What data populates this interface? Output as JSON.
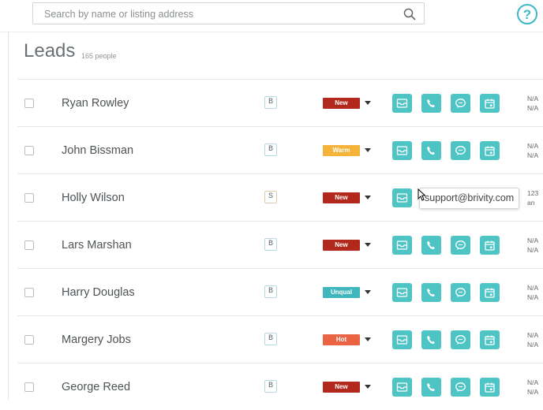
{
  "search": {
    "placeholder": "Search by name or listing address"
  },
  "page": {
    "title": "Leads",
    "count": "165 people"
  },
  "leads": [
    {
      "name": "Ryan Rowley",
      "type": "B",
      "status": "New",
      "status_color": "#b2281d",
      "meta": [
        "N/A",
        "N/A"
      ]
    },
    {
      "name": "John Bissman",
      "type": "B",
      "status": "Warm",
      "status_color": "#f6b33a",
      "meta": [
        "N/A",
        "N/A"
      ]
    },
    {
      "name": "Holly Wilson",
      "type": "S",
      "status": "New",
      "status_color": "#b2281d",
      "meta": [
        "123",
        "an"
      ]
    },
    {
      "name": "Lars Marshan",
      "type": "B",
      "status": "New",
      "status_color": "#b2281d",
      "meta": [
        "N/A",
        "N/A"
      ]
    },
    {
      "name": "Harry Douglas",
      "type": "B",
      "status": "Unqual",
      "status_color": "#3fb7bd",
      "meta": [
        "N/A",
        "N/A"
      ]
    },
    {
      "name": "Margery Jobs",
      "type": "B",
      "status": "Hot",
      "status_color": "#ea6443",
      "meta": [
        "N/A",
        "N/A"
      ]
    },
    {
      "name": "George Reed",
      "type": "B",
      "status": "New",
      "status_color": "#b2281d",
      "meta": [
        "N/A",
        "N/A"
      ]
    }
  ],
  "actions": [
    "email-icon",
    "phone-icon",
    "chat-icon",
    "calendar-icon"
  ],
  "tooltip": {
    "text": "support@brivity.com"
  },
  "colors": {
    "accent": "#4fc4c4",
    "help": "#3db8c6"
  }
}
